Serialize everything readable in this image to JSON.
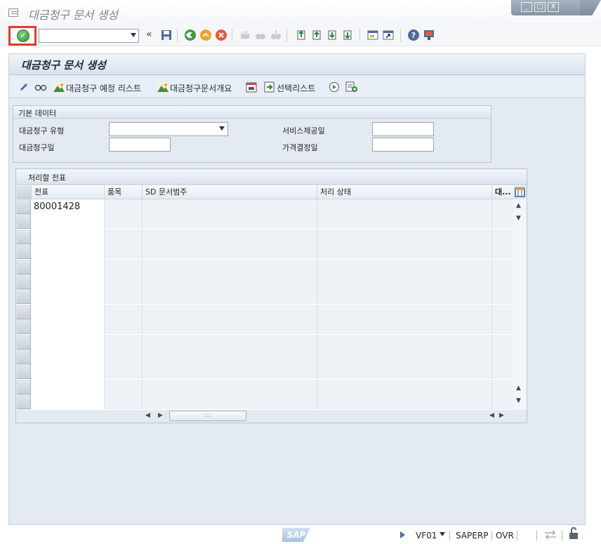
{
  "window": {
    "title": "대금청구 문서 생성",
    "controls": [
      "_",
      "□",
      "X"
    ]
  },
  "systoolbar": {
    "command_field_value": "",
    "back_chevron": "«"
  },
  "screen": {
    "title": "대금청구 문서 생성"
  },
  "apptoolbar": {
    "billing_due_list": "대금청구 예정 리스트",
    "billing_doc_overview": "대금청구문서개요",
    "selection_list": "선택리스트"
  },
  "basic_data": {
    "title": "기본 데이터",
    "billing_type_label": "대금청구 유형",
    "billing_type_value": "",
    "billing_date_label": "대금청구일",
    "billing_date_value": "",
    "service_date_label": "서비스제공일",
    "service_date_value": "",
    "pricing_date_label": "가격결정일",
    "pricing_date_value": ""
  },
  "documents": {
    "title": "처리할 전표",
    "columns": [
      "전표",
      "품목",
      "SD 문서범주",
      "처리 상태",
      "대..."
    ],
    "rows": [
      {
        "doc": "80001428",
        "item": "",
        "category": "",
        "status": ""
      },
      {
        "doc": "",
        "item": "",
        "category": "",
        "status": ""
      },
      {
        "doc": "",
        "item": "",
        "category": "",
        "status": ""
      },
      {
        "doc": "",
        "item": "",
        "category": "",
        "status": ""
      },
      {
        "doc": "",
        "item": "",
        "category": "",
        "status": ""
      },
      {
        "doc": "",
        "item": "",
        "category": "",
        "status": ""
      },
      {
        "doc": "",
        "item": "",
        "category": "",
        "status": ""
      },
      {
        "doc": "",
        "item": "",
        "category": "",
        "status": ""
      },
      {
        "doc": "",
        "item": "",
        "category": "",
        "status": ""
      },
      {
        "doc": "",
        "item": "",
        "category": "",
        "status": ""
      },
      {
        "doc": "",
        "item": "",
        "category": "",
        "status": ""
      },
      {
        "doc": "",
        "item": "",
        "category": "",
        "status": ""
      },
      {
        "doc": "",
        "item": "",
        "category": "",
        "status": ""
      },
      {
        "doc": "",
        "item": "",
        "category": "",
        "status": ""
      }
    ]
  },
  "statusbar": {
    "sap_logo": "SAP",
    "transaction": "VF01",
    "system": "SAPERP",
    "mode": "OVR"
  },
  "colors": {
    "enter_highlight": "#e23a2d",
    "frame_bg": "#e3eaf2",
    "header_text": "#1d2b3a"
  }
}
